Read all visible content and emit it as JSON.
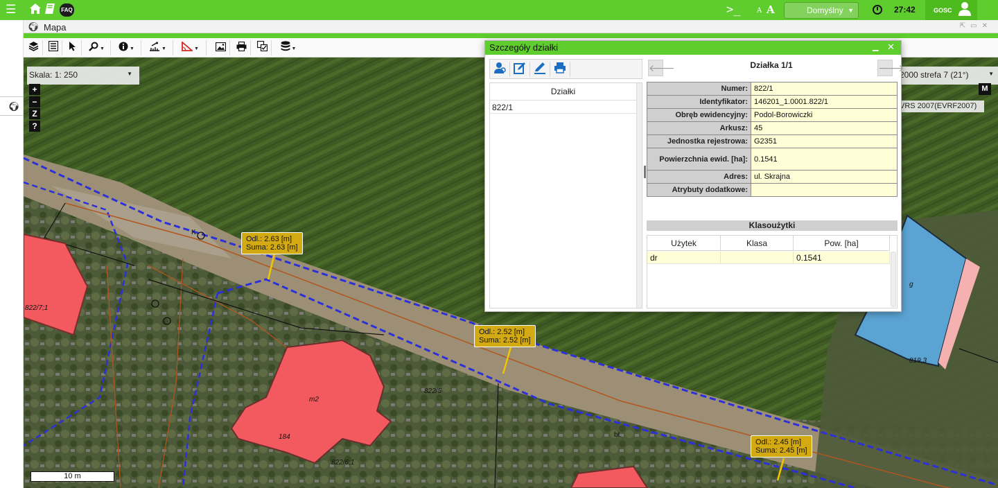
{
  "topbar": {
    "menu_icon": "hamburger-icon",
    "home_icon": "home-icon",
    "book_icon": "book-icon",
    "faq_label": "FAQ",
    "terminal_label": ">_",
    "font_small_label": "A",
    "font_large_label": "A",
    "profile_value": "Domyślny",
    "time": "27:42",
    "user_label": "GOSC",
    "colors": {
      "bar": "#5fcd2e",
      "user_area": "#4dbb1e"
    }
  },
  "map_window": {
    "title": "Mapa",
    "toolbar_icons": [
      "layers-icon",
      "legend-icon",
      "pointer-icon",
      "search-icon",
      "info-icon",
      "measure-icon",
      "angle-measure-icon",
      "image-icon",
      "print-icon",
      "selection-icon",
      "database-icon"
    ]
  },
  "map": {
    "scale_label": "Skala:",
    "scale_value": "1: 250",
    "zoom_in": "+",
    "zoom_out": "−",
    "zoom_z": "Z",
    "help": "?",
    "crs_value": "2000 strefa 7 (21°)",
    "m_button": "M",
    "height_system": "VRS 2007(EVRF2007)",
    "scale_bar": "10 m",
    "measurements": [
      {
        "distance": "Odl.: 2.63 [m]",
        "sum": "Suma: 2.63 [m]"
      },
      {
        "distance": "Odl.: 2.52 [m]",
        "sum": "Suma: 2.52 [m]"
      },
      {
        "distance": "Odl.: 2.45 [m]",
        "sum": "Suma: 2.45 [m]"
      }
    ],
    "map_labels": {
      "m2": "m2",
      "g": "g",
      "p184": "184",
      "p819": "819,3",
      "p822_7_1": "822/7;1",
      "p822_6_1": "822/6;1",
      "p822_5": "822/5",
      "bt": "bt.",
      "k": "K"
    }
  },
  "details": {
    "title": "Szczegóły działki",
    "toolbar_icons": [
      "locate-parcel-icon",
      "edit-icon",
      "pencil-icon",
      "print-icon"
    ],
    "list_header": "Działki",
    "list_items": [
      "822/1"
    ],
    "heading": "Działka 1/1",
    "attributes": [
      {
        "key": "Numer:",
        "value": "822/1"
      },
      {
        "key": "Identyfikator:",
        "value": "146201_1.0001.822/1"
      },
      {
        "key": "Obręb ewidencyjny:",
        "value": "Podol-Borowiczki"
      },
      {
        "key": "Arkusz:",
        "value": "45"
      },
      {
        "key": "Jednostka rejestrowa:",
        "value": "G2351"
      },
      {
        "key": "Powierzchnia ewid. [ha]:",
        "value": "0.1541"
      },
      {
        "key": "Adres:",
        "value": "ul. Skrajna"
      },
      {
        "key": "Atrybuty dodatkowe:",
        "value": ""
      }
    ],
    "klasouzytki_title": "Klasoużytki",
    "klas_columns": [
      "Użytek",
      "Klasa",
      "Pow. [ha]"
    ],
    "klas_rows": [
      {
        "uzytek": "dr",
        "klasa": "",
        "pow": "0.1541"
      }
    ]
  }
}
